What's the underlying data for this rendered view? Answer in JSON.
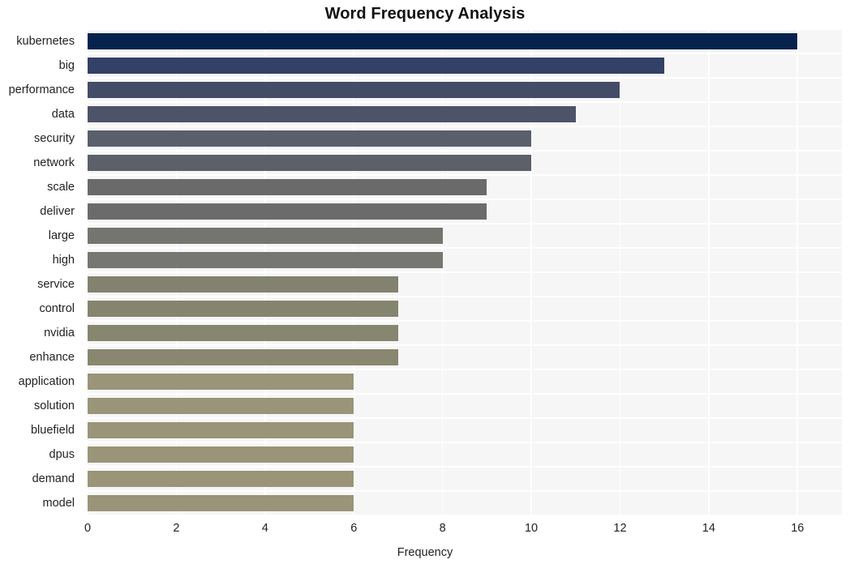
{
  "chart_data": {
    "type": "bar",
    "orientation": "horizontal",
    "title": "Word Frequency Analysis",
    "xlabel": "Frequency",
    "ylabel": "",
    "xlim": [
      0,
      17
    ],
    "ylim_categories": 20,
    "grid": true,
    "legend": null,
    "xticks": [
      0,
      2,
      4,
      6,
      8,
      10,
      12,
      14,
      16
    ],
    "xtick_labels": [
      "0",
      "2",
      "4",
      "6",
      "8",
      "10",
      "12",
      "14",
      "16"
    ],
    "categories": [
      "kubernetes",
      "big",
      "performance",
      "data",
      "security",
      "network",
      "scale",
      "deliver",
      "large",
      "high",
      "service",
      "control",
      "nvidia",
      "enhance",
      "application",
      "solution",
      "bluefield",
      "dpus",
      "demand",
      "model"
    ],
    "values": [
      16,
      13,
      12,
      11,
      10,
      10,
      9,
      9,
      8,
      8,
      7,
      7,
      7,
      7,
      6,
      6,
      6,
      6,
      6,
      6
    ],
    "bar_colors": [
      "#05234d",
      "#334167",
      "#444d68",
      "#4d5469",
      "#5a5f6c",
      "#5c6068",
      "#6a6a6a",
      "#6b6b6b",
      "#757570",
      "#777772",
      "#83826f",
      "#85846f",
      "#87866f",
      "#89876f",
      "#9a9478",
      "#9a9478",
      "#9a9478",
      "#9a9478",
      "#9a9478",
      "#9a9478"
    ],
    "plot_background": "#f6f6f7",
    "gridline_color": "#ffffff",
    "figure_background": "#ffffff"
  }
}
